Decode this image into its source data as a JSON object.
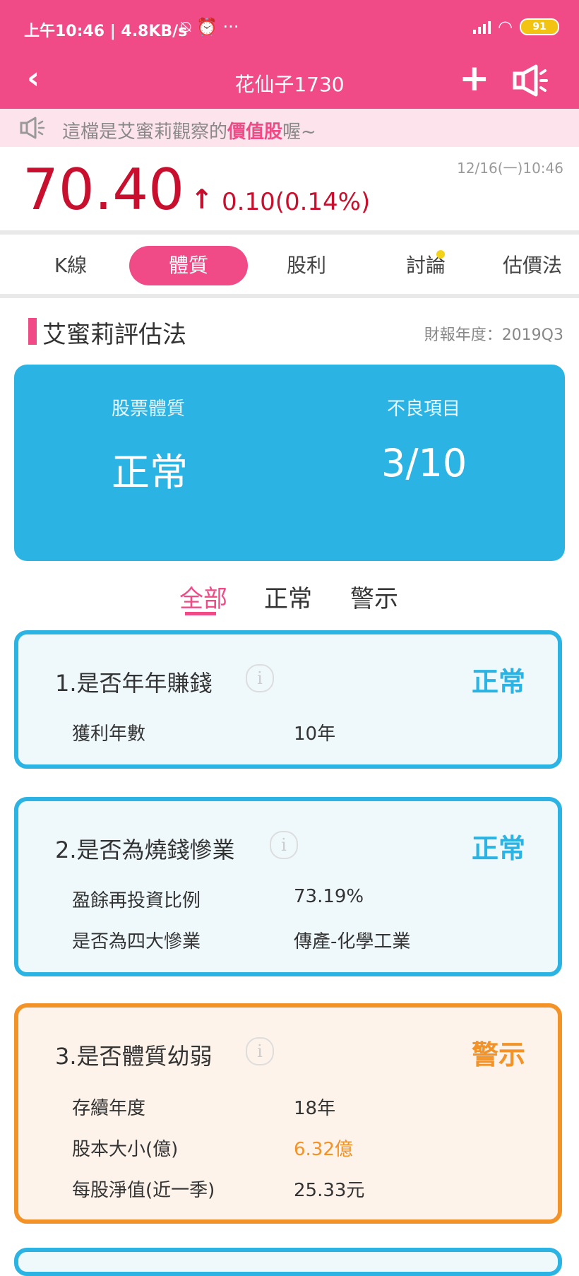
{
  "status_bar": {
    "time": "上午10:46 | 4.8KB/s",
    "icons": "⍉ ⏰ ···",
    "battery": "91"
  },
  "header": {
    "back_icon": "‹",
    "title": "花仙子1730",
    "plus_icon": "+"
  },
  "notice": {
    "prefix": "這檔是艾蜜莉觀察的",
    "highlight": "價值股",
    "suffix": "喔~"
  },
  "quote": {
    "price": "70.40",
    "arrow": "↑",
    "change": "0.10(0.14%)",
    "datetime": "12/16(一)10:46"
  },
  "tabs": [
    {
      "label": "K線"
    },
    {
      "label": "體質"
    },
    {
      "label": "股利"
    },
    {
      "label": "討論"
    },
    {
      "label": "估價法"
    }
  ],
  "section": {
    "title": "艾蜜莉評估法",
    "report_year": "財報年度：2019Q3"
  },
  "summary": {
    "quality_label": "股票體質",
    "quality_value": "正常",
    "bad_label": "不良項目",
    "bad_value": "3/10"
  },
  "filters": [
    {
      "label": "全部"
    },
    {
      "label": "正常"
    },
    {
      "label": "警示"
    }
  ],
  "cards": [
    {
      "title": "1.是否年年賺錢",
      "status": "正常",
      "rows": [
        {
          "label": "獲利年數",
          "value": "10年"
        }
      ]
    },
    {
      "title": "2.是否為燒錢慘業",
      "status": "正常",
      "rows": [
        {
          "label": "盈餘再投資比例",
          "value": "73.19%"
        },
        {
          "label": "是否為四大慘業",
          "value": "傳產-化學工業"
        }
      ]
    },
    {
      "title": "3.是否體質幼弱",
      "status": "警示",
      "rows": [
        {
          "label": "存續年度",
          "value": "18年"
        },
        {
          "label": "股本大小(億)",
          "value": "6.32億"
        },
        {
          "label": "每股淨值(近一季)",
          "value": "25.33元"
        }
      ]
    }
  ],
  "colors": {
    "brand_pink": "#f04a87",
    "price_red": "#c8102e",
    "ok_blue": "#2bb3e3",
    "warn_orange": "#f39227"
  }
}
